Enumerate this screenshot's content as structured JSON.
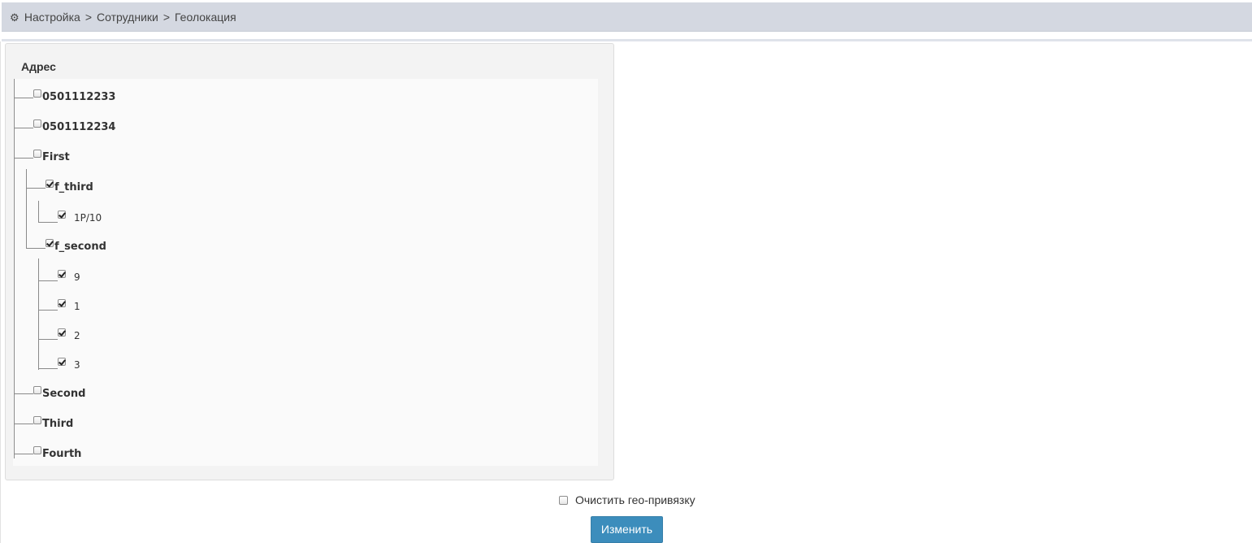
{
  "breadcrumb": {
    "icon": "gear-icon",
    "items": [
      "Настройка",
      "Сотрудники",
      "Геолокация"
    ],
    "separator": ">"
  },
  "panel": {
    "title": "Адрес"
  },
  "tree": {
    "nodes": [
      {
        "label": "0501112233",
        "checked": false
      },
      {
        "label": "0501112234",
        "checked": false
      },
      {
        "label": "First",
        "checked": false
      },
      {
        "label": "f_third",
        "checked": true
      },
      {
        "label": "1P/10",
        "checked": true
      },
      {
        "label": "f_second",
        "checked": true
      },
      {
        "label": "9",
        "checked": true
      },
      {
        "label": "1",
        "checked": true
      },
      {
        "label": "2",
        "checked": true
      },
      {
        "label": "3",
        "checked": true
      },
      {
        "label": "Second",
        "checked": false
      },
      {
        "label": "Third",
        "checked": false
      },
      {
        "label": "Fourth",
        "checked": false
      }
    ]
  },
  "form": {
    "clear_label": "Очистить гео-привязку",
    "clear_checked": false,
    "submit_label": "Изменить"
  },
  "colors": {
    "breadcrumb_bg": "#d4d8e1",
    "button_bg": "#3c8dbc",
    "panel_bg": "#f3f3f3"
  }
}
